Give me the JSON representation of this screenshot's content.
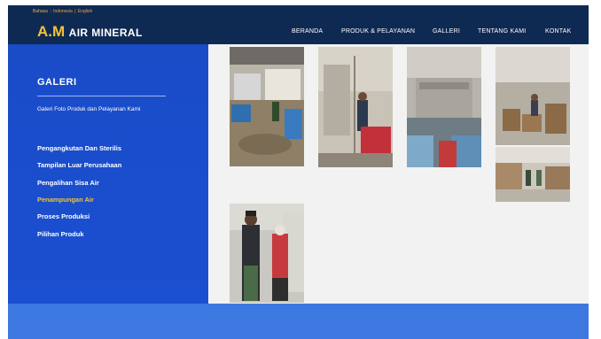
{
  "header": {
    "language": {
      "label": "Bahasa",
      "separator1": ":",
      "option1": "Indonesia",
      "separator2": "|",
      "option2": "English"
    },
    "logo": {
      "am": "A.M",
      "rest": "AIR MINERAL"
    },
    "nav": [
      "BERANDA",
      "PRODUK & PELAYANAN",
      "GALLERI",
      "TENTANG KAMI",
      "KONTAK"
    ]
  },
  "sidebar": {
    "title": "GALERI",
    "subtitle": "Galeri Foto Produk dan Pelayanan Kami",
    "menu": [
      "Pengangkutan Dan Sterilis",
      "Tampilan Luar Perusahaan",
      "Pengalihan Sisa Air",
      "Penampungan Air",
      "Proses Produksi",
      "Pilihan Produk"
    ],
    "active_index": 3
  },
  "colors": {
    "header_bg": "#0f2a52",
    "sidebar_bg": "#1a4cc8",
    "accent_yellow": "#f2c23a",
    "gallery_bg": "#f2f2f2",
    "footer_bg": "#3c78e0"
  }
}
